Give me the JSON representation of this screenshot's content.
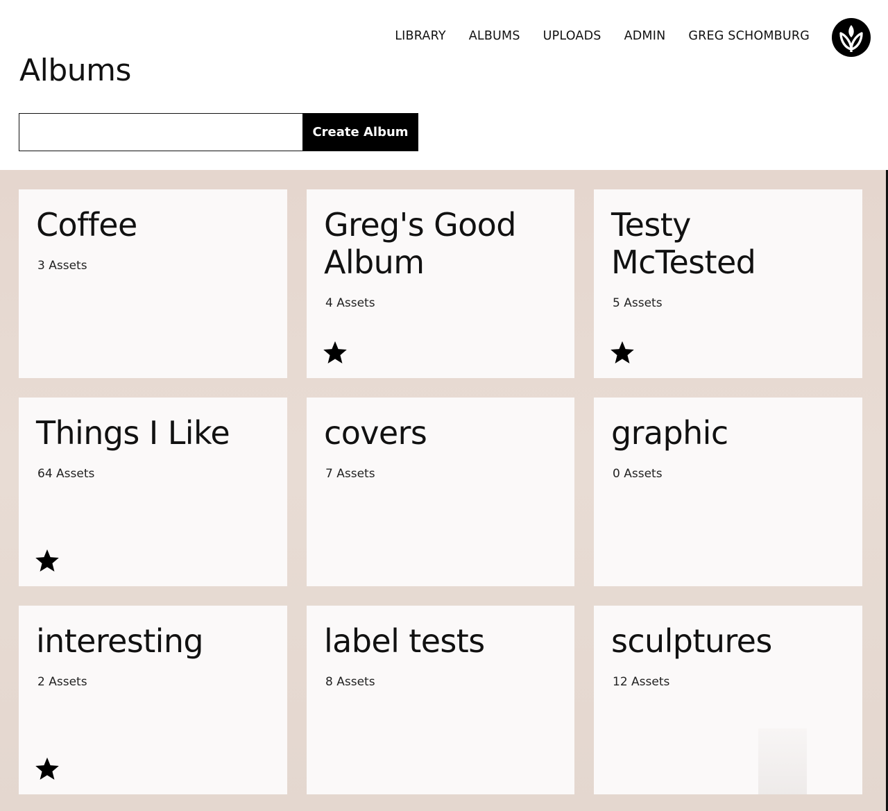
{
  "nav": {
    "items": [
      {
        "label": "LIBRARY"
      },
      {
        "label": "ALBUMS"
      },
      {
        "label": "UPLOADS"
      },
      {
        "label": "ADMIN"
      },
      {
        "label": "GREG SCHOMBURG"
      }
    ],
    "logo_icon": "wheat-leaf-logo-icon"
  },
  "page": {
    "title": "Albums"
  },
  "create_form": {
    "input_value": "",
    "input_placeholder": "",
    "button_label": "Create Album"
  },
  "albums": [
    {
      "name": "Coffee",
      "count": "3 Assets",
      "starred": false
    },
    {
      "name": "Greg's Good Album",
      "count": "4 Assets",
      "starred": true
    },
    {
      "name": "Testy McTested",
      "count": "5 Assets",
      "starred": true
    },
    {
      "name": "Things I Like",
      "count": "64 Assets",
      "starred": true
    },
    {
      "name": "covers",
      "count": "7 Assets",
      "starred": false
    },
    {
      "name": "graphic",
      "count": "0 Assets",
      "starred": false
    },
    {
      "name": "interesting",
      "count": "2 Assets",
      "starred": true
    },
    {
      "name": "label tests",
      "count": "8 Assets",
      "starred": false
    },
    {
      "name": "sculptures",
      "count": "12 Assets",
      "starred": false
    }
  ],
  "colors": {
    "background_band": "#e6d8d0",
    "card": "#fbf9f9",
    "button": "#000000",
    "text": "#111111"
  },
  "icons": {
    "star": "star-icon"
  }
}
